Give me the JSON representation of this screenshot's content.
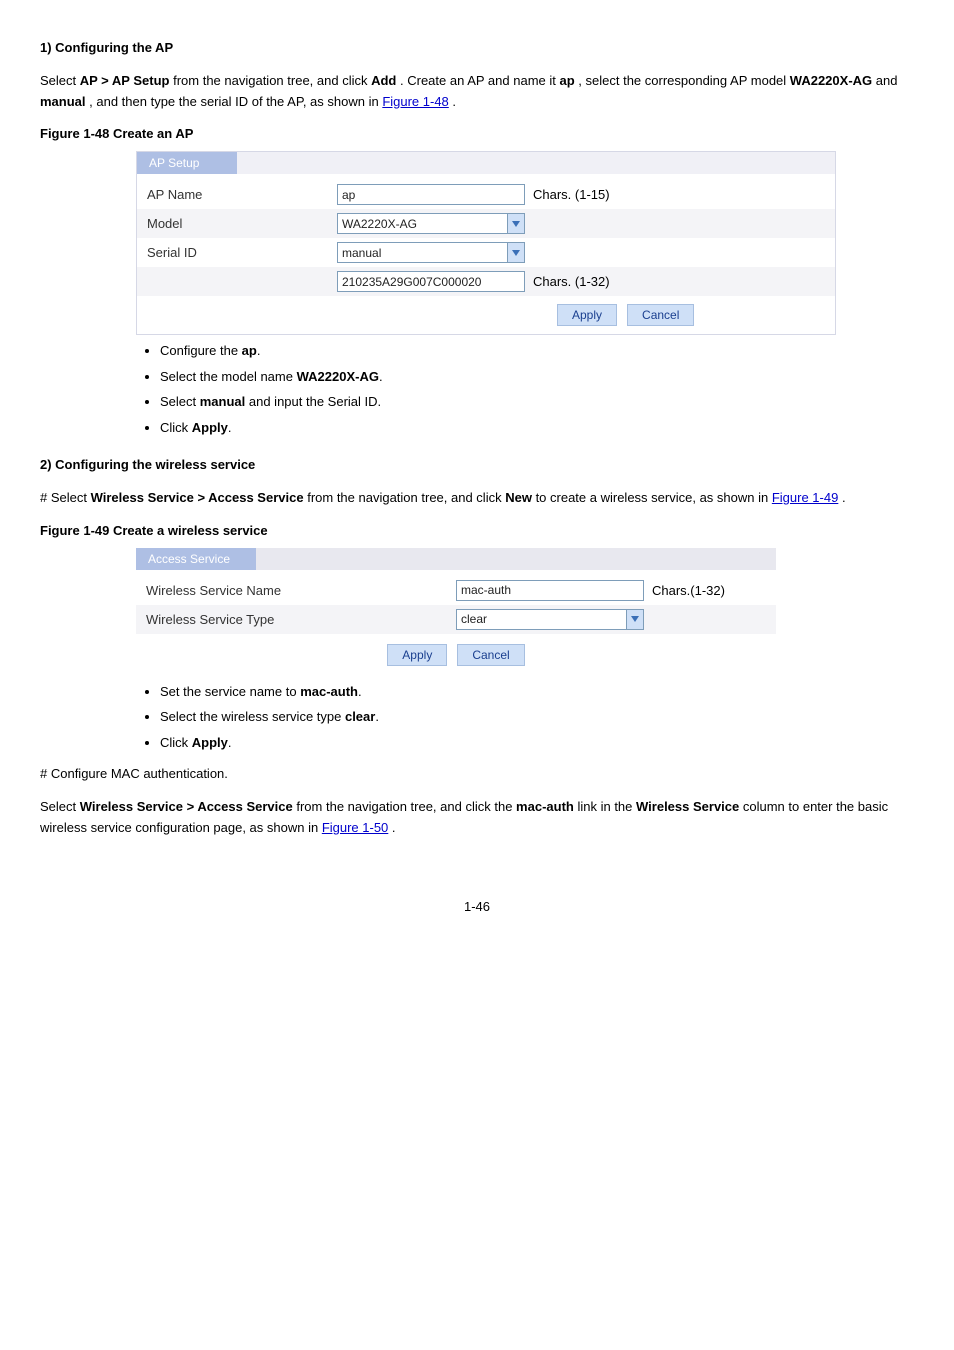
{
  "step1": {
    "heading": "1) Configuring the AP",
    "line1_prefix": "Select ",
    "line1_bold": "AP > AP Setup",
    "line1_cont": " from the navigation tree, and click ",
    "line1_bold2": "Add",
    "line1_suffix": ". Create an AP and name it ",
    "line1_bold3": "ap",
    "line1_suffix2": ", select the corresponding AP model ",
    "line1_bold4": "WA2220X-AG",
    "line1_suffix3": " and ",
    "line1_bold5": "manual",
    "line1_suffix4": ", and then type the serial ID of the AP, as shown in ",
    "link": "Figure 1-48",
    "line1_end": "."
  },
  "fig48_caption": "Figure 1-48 Create an AP",
  "ap_setup": {
    "panel_title": "AP Setup",
    "ap_name_label": "AP Name",
    "ap_name_value": "ap",
    "ap_name_hint": "Chars. (1-15)",
    "model_label": "Model",
    "model_value": "WA2220X-AG",
    "serial_label": "Serial ID",
    "serial_select_value": "manual",
    "serial_value": "210235A29G007C000020",
    "serial_hint": "Chars. (1-32)",
    "apply": "Apply",
    "cancel": "Cancel"
  },
  "bullets1": [
    {
      "prefix": "Configure the ",
      "bold": "ap",
      "suffix": "."
    },
    {
      "prefix": "Select the model name ",
      "bold": "WA2220X-AG",
      "suffix": "."
    },
    {
      "prefix": "Select ",
      "bold": "manual",
      "suffix": " and input the Serial ID."
    },
    {
      "text_plain": "Click ",
      "bold": "Apply",
      "suffix": "."
    }
  ],
  "step2": {
    "heading": "2) Configuring the wireless service",
    "line1_prefix": "# Select ",
    "line1_bold": "Wireless Service > Access Service",
    "line1_cont": " from the navigation tree, and click ",
    "line1_bold2": "New",
    "line1_suffix": " to create a wireless service, as shown in ",
    "link": "Figure 1-49",
    "line1_end": "."
  },
  "fig49_caption": "Figure 1-49 Create a wireless service",
  "access_service": {
    "panel_title": "Access Service",
    "name_label": "Wireless Service Name",
    "name_value": "mac-auth",
    "name_hint": "Chars.(1-32)",
    "type_label": "Wireless Service Type",
    "type_value": "clear",
    "apply": "Apply",
    "cancel": "Cancel"
  },
  "bullets2": [
    {
      "prefix": "Set the service name to ",
      "bold": "mac-auth",
      "suffix": "."
    },
    {
      "prefix": "Select the wireless service type ",
      "bold": "clear",
      "suffix": "."
    },
    {
      "prefix": "Click ",
      "bold": "Apply",
      "suffix": "."
    }
  ],
  "step3": {
    "line1": "# Configure MAC authentication.",
    "line2_prefix": "Select ",
    "line2_bold": "Wireless Service > Access Service",
    "line2_cont": " from the navigation tree, and click the ",
    "line2_bold2": "mac-auth",
    "line2_cont2": " link in the ",
    "line2_bold3": "Wireless Service",
    "line2_cont3": " column to enter the basic wireless service configuration page, as shown in ",
    "link": "Figure 1-50",
    "line2_end": "."
  },
  "page_number": "1-46"
}
